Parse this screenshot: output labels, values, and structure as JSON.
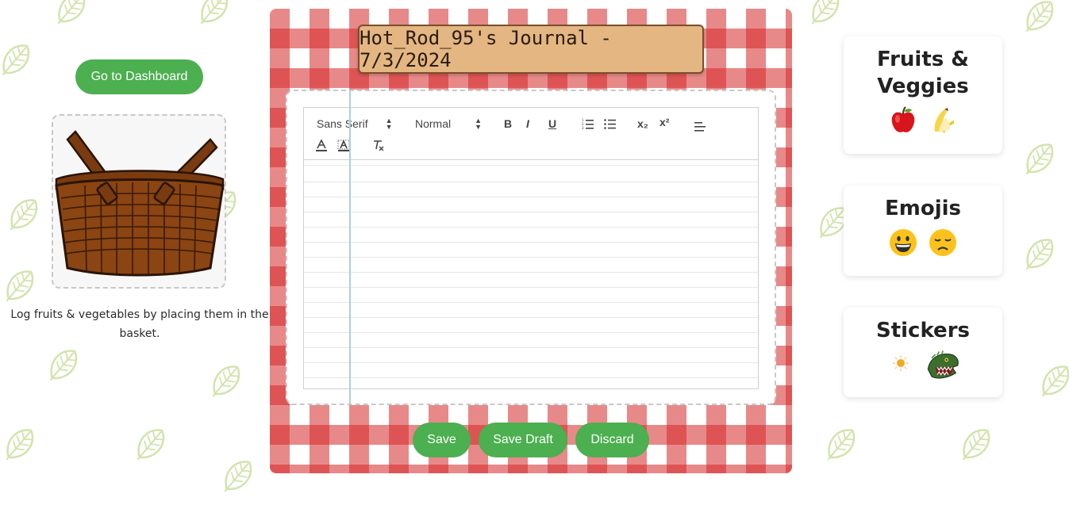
{
  "left": {
    "dashboard_button": "Go to Dashboard",
    "basket_caption": "Log fruits & vegetables by placing them in the basket."
  },
  "journal": {
    "title": "Hot_Rod_95's Journal - 7/3/2024",
    "toolbar": {
      "font_select": "Sans Serif",
      "size_select": "Normal",
      "bold": "B",
      "italic": "I",
      "underline": "U",
      "subscript": "x₂",
      "superscript": "x²"
    },
    "buttons": {
      "save": "Save",
      "save_draft": "Save Draft",
      "discard": "Discard"
    }
  },
  "panels": {
    "fruits": {
      "title_line1": "Fruits &",
      "title_line2": "Veggies",
      "items": [
        "apple-icon",
        "banana-icon"
      ]
    },
    "emojis": {
      "title": "Emojis",
      "items": [
        "grinning-face-icon",
        "disappointed-face-icon"
      ]
    },
    "stickers": {
      "title": "Stickers",
      "items": [
        "sun-sticker-icon",
        "dinosaur-sticker-icon"
      ]
    }
  },
  "colors": {
    "accent_green": "#4caf50",
    "gingham_red": "#d62828",
    "plate_tan": "#e3b682"
  }
}
